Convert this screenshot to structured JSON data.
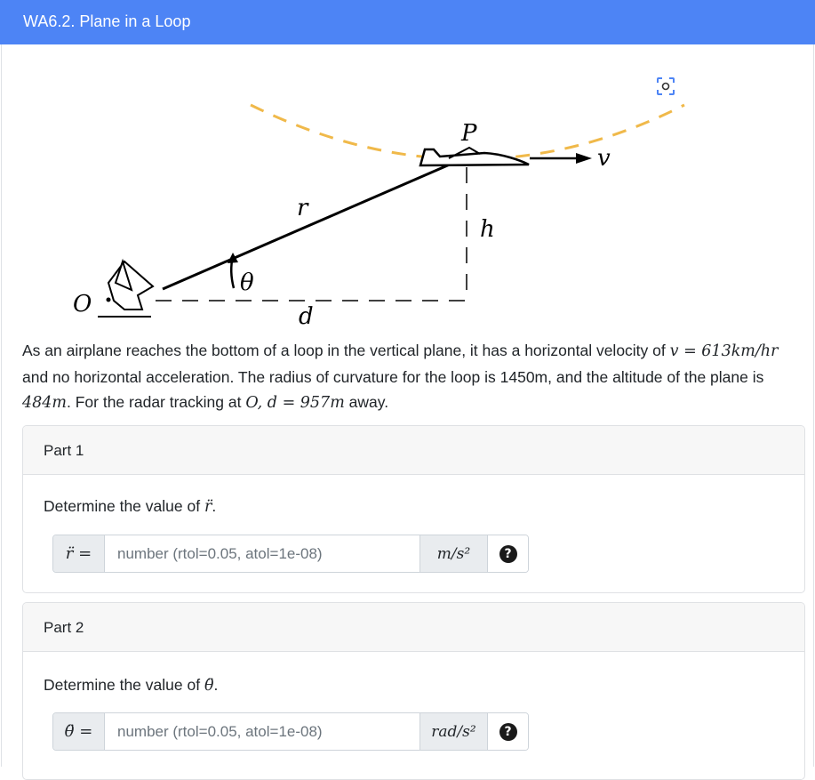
{
  "header": {
    "title": "WA6.2. Plane in a Loop"
  },
  "figure": {
    "label_P": "P",
    "label_v": "v",
    "label_r": "r",
    "label_h": "h",
    "label_theta": "θ",
    "label_O": "O",
    "label_d": "d",
    "expand_icon": "expand-icon"
  },
  "problem": {
    "line1_pre": "As an airplane reaches the bottom of a loop in the vertical plane, it has a horizontal velocity of ",
    "v_eq": "v = 613km/hr",
    "line2": " and no horizontal acceleration. The radius of curvature for the loop is 1450m, and the altitude of the plane is ",
    "alt": "484m",
    "line3_pre": ". For the radar tracking at ",
    "O": "O",
    "d_eq": ", d = 957m",
    "line3_post": " away."
  },
  "parts": [
    {
      "header": "Part 1",
      "question": "Determine the value of ",
      "symbol": "r̈",
      "prefix": "r̈ =",
      "placeholder": "number (rtol=0.05, atol=1e-08)",
      "unit": "m/s²",
      "help": "?"
    },
    {
      "header": "Part 2",
      "question": "Determine the value of ",
      "symbol": "θ̈",
      "prefix": "θ̈ =",
      "placeholder": "number (rtol=0.05, atol=1e-08)",
      "unit": "rad/s²",
      "help": "?"
    }
  ]
}
